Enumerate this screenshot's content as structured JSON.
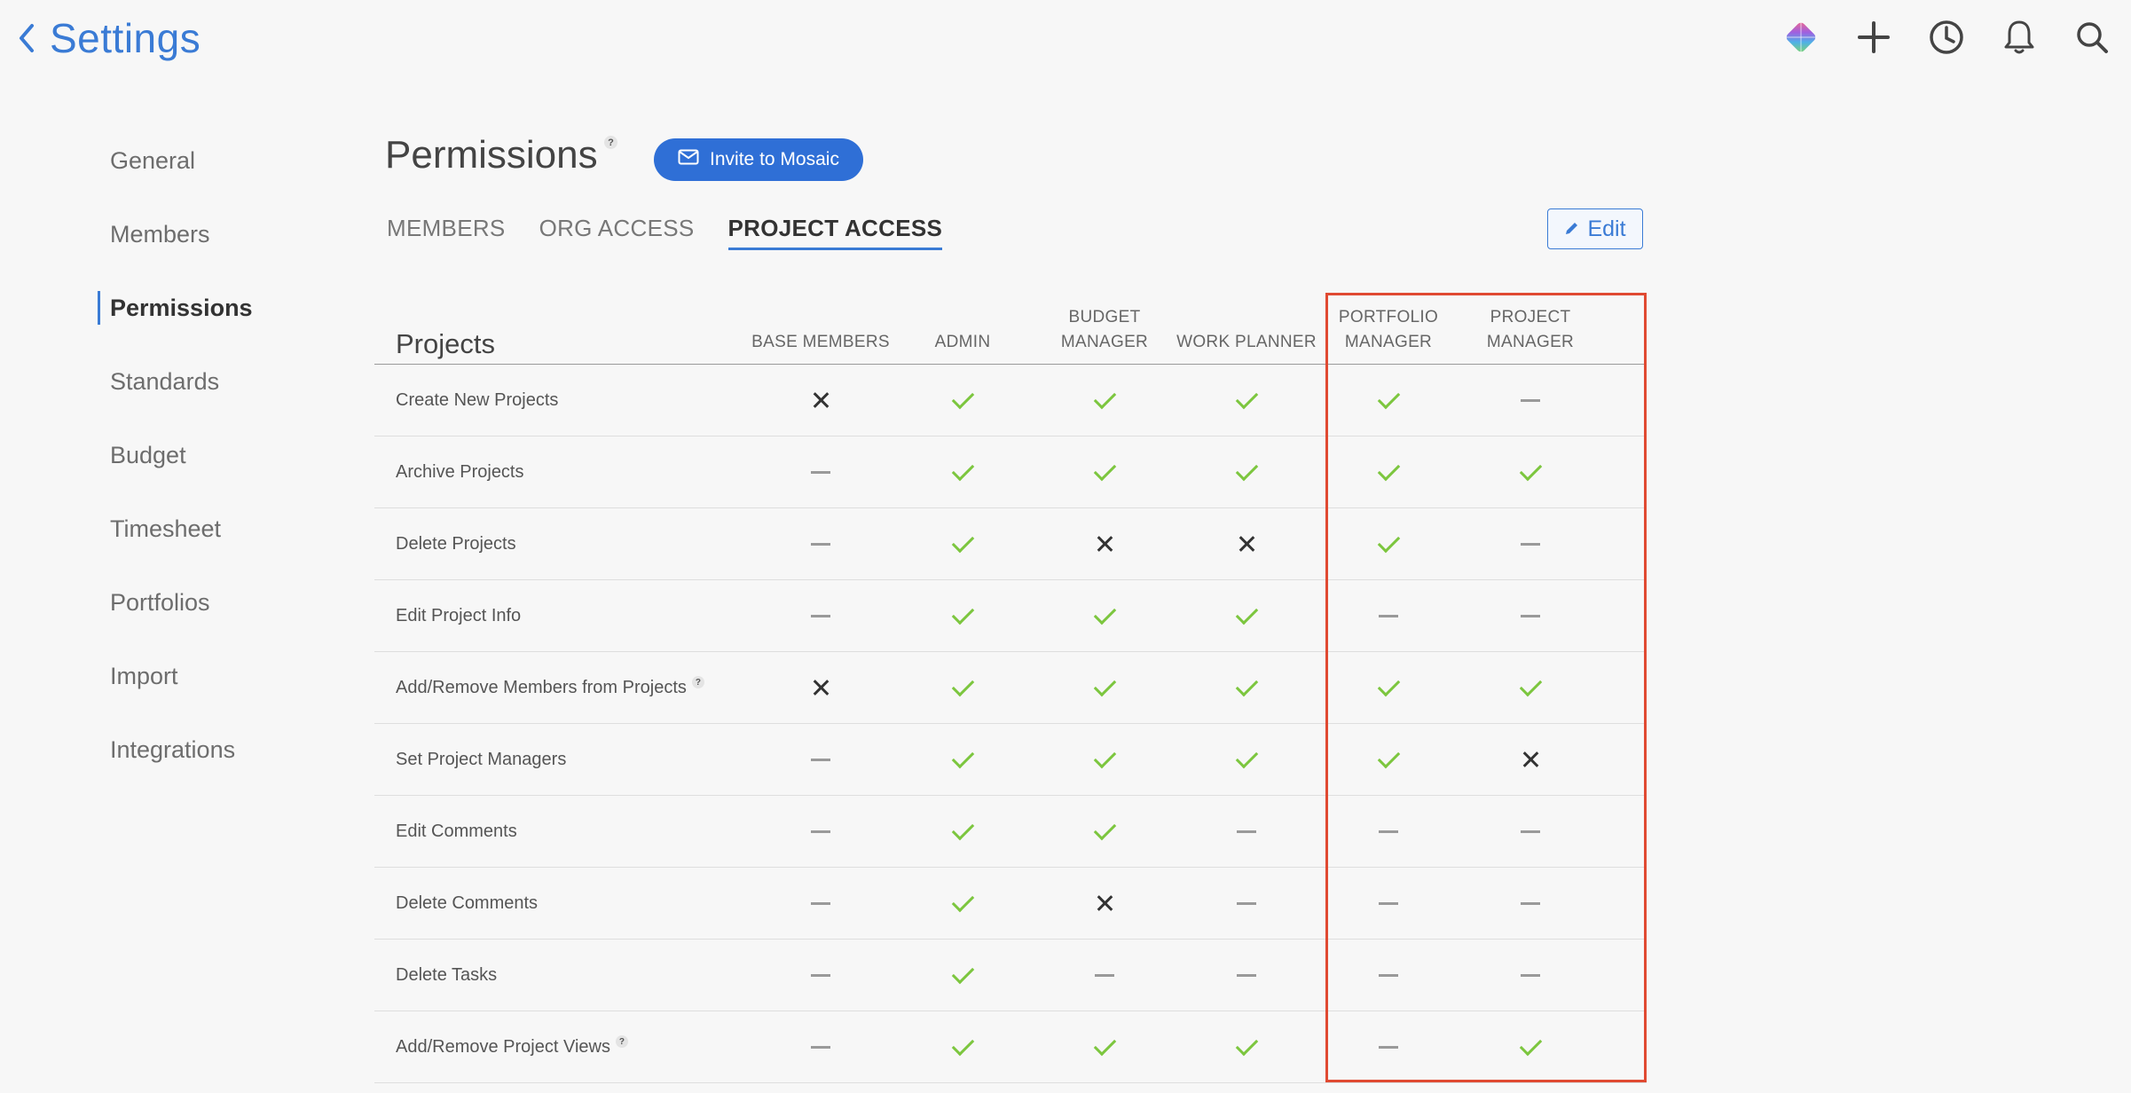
{
  "header": {
    "title": "Settings",
    "icons": [
      "mosaic-logo-icon",
      "plus-icon",
      "clock-icon",
      "bell-icon",
      "search-icon"
    ]
  },
  "sidebar": {
    "items": [
      {
        "label": "General"
      },
      {
        "label": "Members"
      },
      {
        "label": "Permissions",
        "active": true
      },
      {
        "label": "Standards"
      },
      {
        "label": "Budget"
      },
      {
        "label": "Timesheet"
      },
      {
        "label": "Portfolios"
      },
      {
        "label": "Import"
      },
      {
        "label": "Integrations"
      }
    ]
  },
  "main": {
    "title": "Permissions",
    "help": "?",
    "invite_label": "Invite to Mosaic",
    "edit_label": "Edit",
    "tabs": [
      {
        "label": "MEMBERS"
      },
      {
        "label": "ORG ACCESS"
      },
      {
        "label": "PROJECT ACCESS",
        "active": true
      }
    ]
  },
  "table": {
    "section": "Projects",
    "columns": [
      {
        "line1": "",
        "line2": "BASE MEMBERS"
      },
      {
        "line1": "",
        "line2": "ADMIN"
      },
      {
        "line1": "BUDGET",
        "line2": "MANAGER"
      },
      {
        "line1": "",
        "line2": "WORK PLANNER"
      },
      {
        "line1": "PORTFOLIO",
        "line2": "MANAGER"
      },
      {
        "line1": "PROJECT",
        "line2": "MANAGER"
      }
    ],
    "rows": [
      {
        "label": "Create New Projects",
        "help": false,
        "values": [
          "cross",
          "check",
          "check",
          "check",
          "check",
          "dash"
        ]
      },
      {
        "label": "Archive Projects",
        "help": false,
        "values": [
          "dash",
          "check",
          "check",
          "check",
          "check",
          "check"
        ]
      },
      {
        "label": "Delete Projects",
        "help": false,
        "values": [
          "dash",
          "check",
          "cross",
          "cross",
          "check",
          "dash"
        ]
      },
      {
        "label": "Edit Project Info",
        "help": false,
        "values": [
          "dash",
          "check",
          "check",
          "check",
          "dash",
          "dash"
        ]
      },
      {
        "label": "Add/Remove Members from Projects",
        "help": true,
        "values": [
          "cross",
          "check",
          "check",
          "check",
          "check",
          "check"
        ]
      },
      {
        "label": "Set Project Managers",
        "help": false,
        "values": [
          "dash",
          "check",
          "check",
          "check",
          "check",
          "cross"
        ]
      },
      {
        "label": "Edit Comments",
        "help": false,
        "values": [
          "dash",
          "check",
          "check",
          "dash",
          "dash",
          "dash"
        ]
      },
      {
        "label": "Delete Comments",
        "help": false,
        "values": [
          "dash",
          "check",
          "cross",
          "dash",
          "dash",
          "dash"
        ]
      },
      {
        "label": "Delete Tasks",
        "help": false,
        "values": [
          "dash",
          "check",
          "dash",
          "dash",
          "dash",
          "dash"
        ]
      },
      {
        "label": "Add/Remove Project Views",
        "help": true,
        "values": [
          "dash",
          "check",
          "check",
          "check",
          "dash",
          "check"
        ]
      }
    ]
  },
  "colors": {
    "accent": "#3a7bd5",
    "invite_bg": "#2f6fd6",
    "check": "#7cc63e",
    "cross": "#333333",
    "dash": "#9a9a9a",
    "highlight": "#e04a32"
  }
}
